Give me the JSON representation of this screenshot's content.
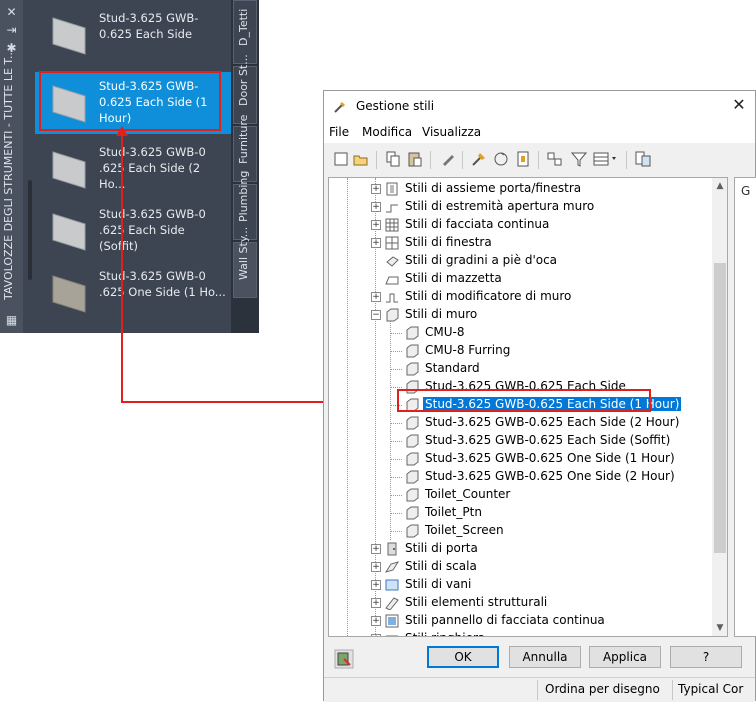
{
  "palette": {
    "title": "TAVOLOZZE DEGLI STRUMENTI - TUTTE LE T...",
    "tools": [
      {
        "label": "Stud-3.625 GWB-\n0.625 Each Side"
      },
      {
        "label": "Stud-3.625 GWB-\n0.625 Each Side (1\nHour)"
      },
      {
        "label": "Stud-3.625 GWB-0\n.625 Each Side (2 Ho..."
      },
      {
        "label": "Stud-3.625 GWB-0\n.625 Each Side (Soffit)"
      },
      {
        "label": "Stud-3.625 GWB-0\n.625 One Side (1 Ho..."
      }
    ],
    "tabs": [
      "D_Tetti",
      "Door St...",
      "Furniture",
      "Plumbing",
      "Wall Sty..."
    ]
  },
  "dialog": {
    "title": "Gestione stili",
    "menu": [
      "File",
      "Modifica",
      "Visualizza"
    ],
    "tree": [
      {
        "label": "Stili di assieme porta/finestra"
      },
      {
        "label": "Stili di estremità apertura muro"
      },
      {
        "label": "Stili di facciata continua"
      },
      {
        "label": "Stili di finestra"
      },
      {
        "label": "Stili di gradini a piè d'oca"
      },
      {
        "label": "Stili di mazzetta"
      },
      {
        "label": "Stili di modificatore di muro"
      },
      {
        "label": "Stili di muro"
      },
      {
        "label": "CMU-8"
      },
      {
        "label": "CMU-8 Furring"
      },
      {
        "label": "Standard"
      },
      {
        "label": "Stud-3.625 GWB-0.625 Each Side"
      },
      {
        "label": "Stud-3.625 GWB-0.625 Each Side (1 Hour)"
      },
      {
        "label": "Stud-3.625 GWB-0.625 Each Side (2 Hour)"
      },
      {
        "label": "Stud-3.625 GWB-0.625 Each Side (Soffit)"
      },
      {
        "label": "Stud-3.625 GWB-0.625 One Side (1 Hour)"
      },
      {
        "label": "Stud-3.625 GWB-0.625 One Side (2 Hour)"
      },
      {
        "label": "Toilet_Counter"
      },
      {
        "label": "Toilet_Ptn"
      },
      {
        "label": "Toilet_Screen"
      },
      {
        "label": "Stili di porta"
      },
      {
        "label": "Stili di scala"
      },
      {
        "label": "Stili di vani"
      },
      {
        "label": "Stili elementi strutturali"
      },
      {
        "label": "Stili pannello di facciata continua"
      },
      {
        "label": "Stili ringhiera"
      }
    ],
    "right_panel_label": "G",
    "buttons": {
      "ok": "OK",
      "cancel": "Annulla",
      "apply": "Applica",
      "help": "?"
    },
    "status": {
      "sort": "Ordina per disegno",
      "type": "Typical Cor"
    }
  },
  "colors": {
    "highlight": "#0078d7",
    "palette_selected": "#0f8fda",
    "callout": "#e0201c"
  }
}
